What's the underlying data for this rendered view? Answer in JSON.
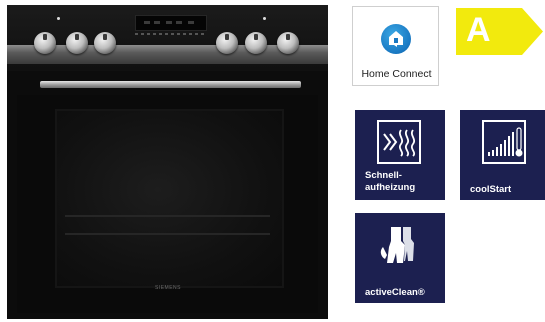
{
  "product": {
    "brand": "SIEMENS"
  },
  "home_connect": {
    "label": "Home Connect",
    "icon": "home-connect-icon",
    "accent": "#1978c2"
  },
  "energy": {
    "class": "A",
    "color": "#f2ea0d"
  },
  "features": [
    {
      "label_line1": "Schnell-",
      "label_line2": "aufheizung",
      "icon": "rapid-heating-icon"
    },
    {
      "label": "coolStart",
      "icon": "cool-start-icon"
    },
    {
      "label": "activeClean®",
      "icon": "active-clean-icon"
    }
  ],
  "colors": {
    "feature_bg": "#1c2050",
    "oven_body": "#0c0c0c"
  }
}
